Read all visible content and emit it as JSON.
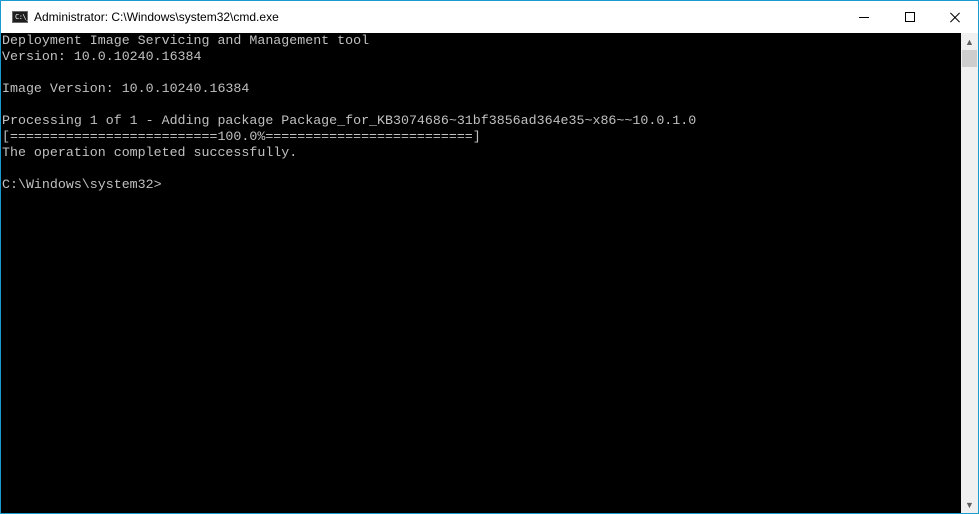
{
  "window": {
    "title": "Administrator: C:\\Windows\\system32\\cmd.exe",
    "icon": "cmd-icon",
    "icon_text": "C:\\_",
    "controls": {
      "minimize": "minimize-icon",
      "maximize": "maximize-icon",
      "close": "close-icon"
    }
  },
  "console": {
    "lines": [
      "Deployment Image Servicing and Management tool",
      "Version: 10.0.10240.16384",
      "",
      "Image Version: 10.0.10240.16384",
      "",
      "Processing 1 of 1 - Adding package Package_for_KB3074686~31bf3856ad364e35~x86~~10.0.1.0",
      "[==========================100.0%==========================]",
      "The operation completed successfully.",
      "",
      "C:\\Windows\\system32>"
    ],
    "progress_percent": 100.0,
    "prompt": "C:\\Windows\\system32>"
  },
  "scrollbar": {
    "up_arrow": "▲",
    "down_arrow": "▼",
    "position": 0
  },
  "colors": {
    "console_bg": "#000000",
    "console_fg": "#c0c0c0",
    "window_border": "#1a9bd0"
  }
}
